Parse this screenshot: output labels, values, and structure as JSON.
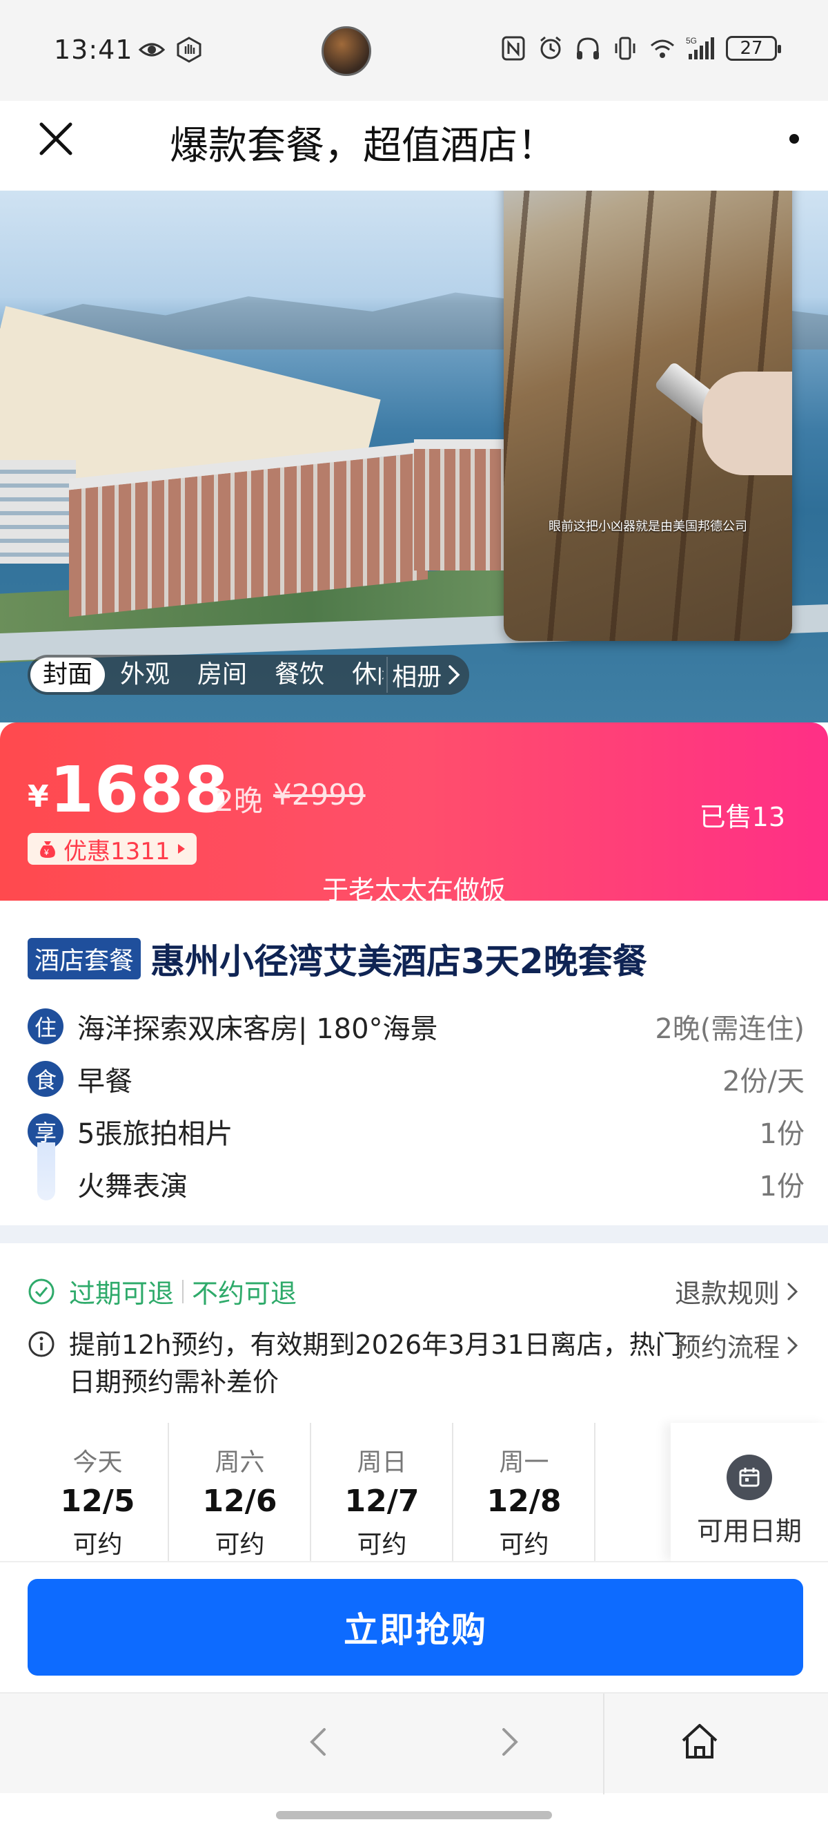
{
  "status_bar": {
    "time": "13:41",
    "left_icons": [
      "eye-icon",
      "hand-icon"
    ],
    "right_icons": [
      "nfc-icon",
      "alarm-icon",
      "headphones-icon",
      "vibrate-icon",
      "wifi-icon",
      "signal-5g-icon"
    ],
    "battery": "27"
  },
  "header": {
    "title": "爆款套餐，超值酒店！",
    "close_icon": "close-icon"
  },
  "hero": {
    "pip_caption": "眼前这把小凶器就是由美国邦德公司",
    "gallery_tabs": [
      "封面",
      "外观",
      "房间",
      "餐饮",
      "休闲"
    ],
    "album_label": "相册"
  },
  "price": {
    "currency": "¥",
    "value": "1688",
    "nights": "2晚",
    "original": "¥2999",
    "discount": "优惠1311",
    "sold": "已售13",
    "overlay_caption": "于老太太在做饭"
  },
  "package": {
    "tag": "酒店套餐",
    "title": "惠州小径湾艾美酒店3天2晚套餐",
    "items": [
      {
        "badge": "住",
        "name": "海洋探索双床客房| 180°海景",
        "qty": "2晚(需连住)"
      },
      {
        "badge": "食",
        "name": "早餐",
        "qty": "2份/天"
      },
      {
        "badge": "享",
        "name": "5張旅拍相片",
        "qty": "1份"
      },
      {
        "badge": "",
        "name": "火舞表演",
        "qty": "1份"
      }
    ]
  },
  "refund": {
    "expire_refund": "过期可退",
    "noshow_refund": "不约可退",
    "rules_label": "退款规则",
    "notice": "提前12h预约，有效期到2026年3月31日离店，热门日期预约需补差价",
    "flow_label": "预约流程"
  },
  "dates": {
    "days": [
      {
        "week": "今天",
        "date": "12/5",
        "status": "可约"
      },
      {
        "week": "周六",
        "date": "12/6",
        "status": "可约"
      },
      {
        "week": "周日",
        "date": "12/7",
        "status": "可约"
      },
      {
        "week": "周一",
        "date": "12/8",
        "status": "可约"
      }
    ],
    "available_label": "可用日期"
  },
  "buy": {
    "label": "立即抢购"
  },
  "colors": {
    "primary_blue": "#0d6bff",
    "navy": "#1f4f9c",
    "banner_red": "#ff4a4e",
    "banner_pink": "#ff2f86",
    "green": "#2eaa6a"
  }
}
